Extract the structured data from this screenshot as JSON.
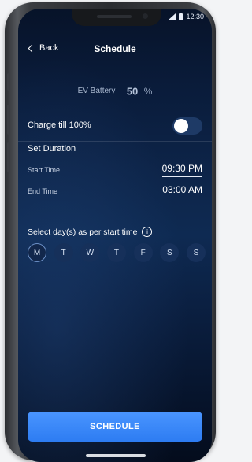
{
  "status_bar": {
    "time": "12:30"
  },
  "header": {
    "back_label": "Back",
    "title": "Schedule"
  },
  "ev_battery": {
    "label": "EV Battery",
    "value": "50",
    "unit": "%"
  },
  "charge_till_full": {
    "label": "Charge till 100%",
    "enabled": false
  },
  "duration": {
    "section_label": "Set Duration",
    "start": {
      "label": "Start Time",
      "value": "09:30 PM"
    },
    "end": {
      "label": "End Time",
      "value": "03:00 AM"
    }
  },
  "days": {
    "label": "Select day(s) as per start time",
    "items": [
      "M",
      "T",
      "W",
      "T",
      "F",
      "S",
      "S"
    ],
    "selected_index": 0
  },
  "cta": {
    "label": "SCHEDULE"
  },
  "colors": {
    "accent": "#3b8bff",
    "background": "#0b1f40"
  }
}
